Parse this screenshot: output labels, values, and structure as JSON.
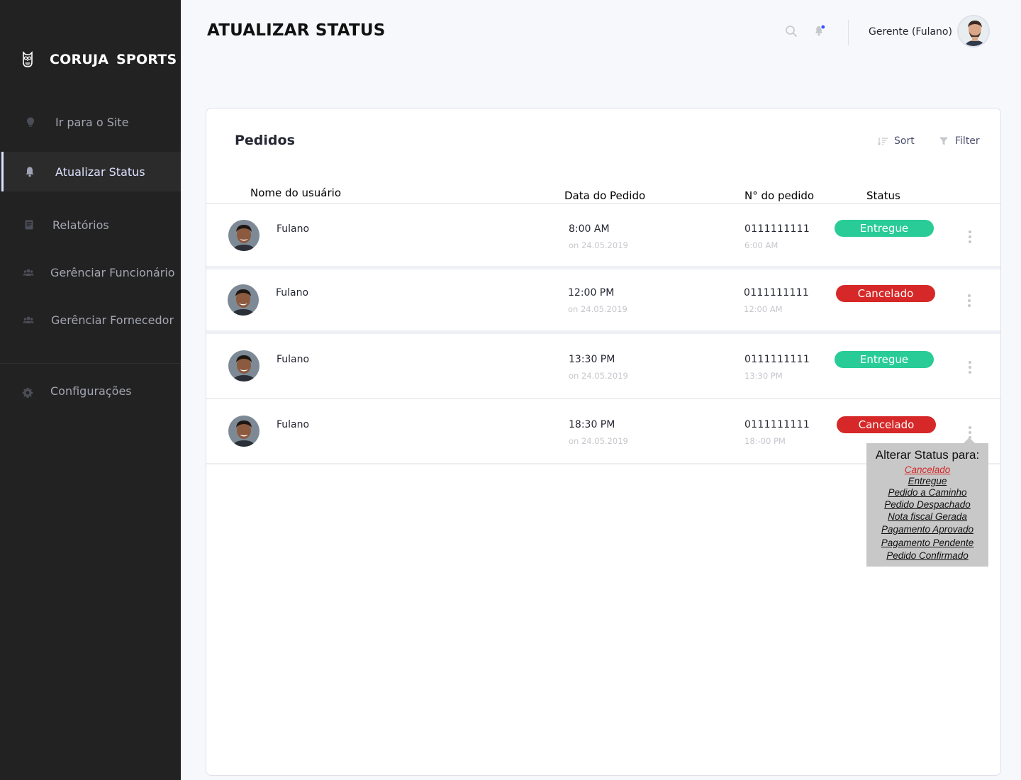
{
  "brand": {
    "name": "CORUJA  SPORTS"
  },
  "sidebar": {
    "items": [
      {
        "label": "Ir para o Site",
        "icon": "lightbulb-icon",
        "active": false
      },
      {
        "label": "Atualizar Status",
        "icon": "bell-icon",
        "active": true
      },
      {
        "label": "Relatórios",
        "icon": "book-icon",
        "active": false
      },
      {
        "label": "Gerênciar Funcionário",
        "icon": "users-icon",
        "active": false
      },
      {
        "label": "Gerênciar Fornecedor",
        "icon": "users-icon",
        "active": false
      },
      {
        "label": "Configurações",
        "icon": "gear-icon",
        "active": false
      }
    ]
  },
  "header": {
    "title": "ATUALIZAR STATUS",
    "user_name": "Gerente (Fulano)",
    "icons": [
      "search-icon",
      "bell-icon"
    ],
    "notification_dot_color": "#3751ff"
  },
  "card": {
    "title": "Pedidos",
    "sort_label": "Sort",
    "filter_label": "Filter",
    "columns": [
      "Nome do usuário",
      "Data do Pedido",
      "N° do pedido",
      "Status"
    ]
  },
  "orders": [
    {
      "name": "Fulano",
      "time": "8:00 AM",
      "date": "on 24.05.2019",
      "number": "0111111111",
      "sub_time": "6:00 AM",
      "status": "Entregue"
    },
    {
      "name": "Fulano",
      "time": "12:00 PM",
      "date": "on 24.05.2019",
      "number": "0111111111",
      "sub_time": "12:00 AM",
      "status": "Cancelado"
    },
    {
      "name": "Fulano",
      "time": "13:30 PM",
      "date": "on 24.05.2019",
      "number": "0111111111",
      "sub_time": "13:30 PM",
      "status": "Entregue"
    },
    {
      "name": "Fulano",
      "time": "18:30 PM",
      "date": "on 24.05.2019",
      "number": "0111111111",
      "sub_time": "18:-00 PM",
      "status": "Cancelado"
    }
  ],
  "status_colors": {
    "Entregue": "#29cc97",
    "Cancelado": "#d62828"
  },
  "dropdown": {
    "title": "Alterar Status para:",
    "options": [
      "Cancelado",
      "Entregue",
      "Pedido a Caminho",
      "Pedido Despachado",
      "Nota fiscal Gerada",
      "Pagamento Aprovado",
      "Pagamento Pendente",
      "Pedido Confirmado"
    ],
    "current": "Cancelado"
  }
}
